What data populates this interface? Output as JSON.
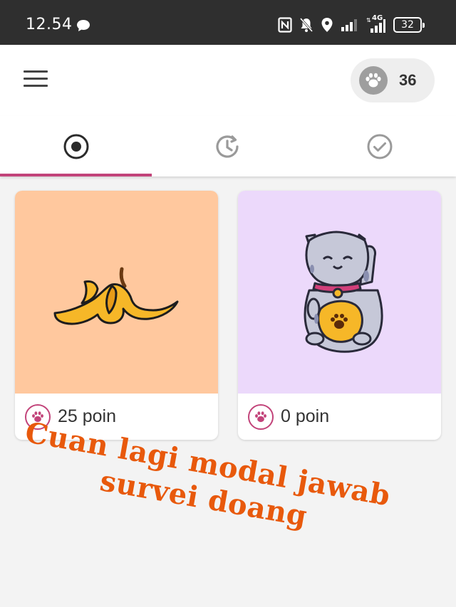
{
  "status_bar": {
    "time": "12.54",
    "network_label": "4G",
    "battery": "32"
  },
  "app_bar": {
    "points": "36"
  },
  "tabs": [
    {
      "icon": "radio-target-icon",
      "active": true
    },
    {
      "icon": "history-icon",
      "active": false
    },
    {
      "icon": "check-circle-icon",
      "active": false
    }
  ],
  "cards": [
    {
      "image": "banana-peel-illustration",
      "background": "#ffc89e",
      "points_text": "25 poin"
    },
    {
      "image": "lucky-cat-illustration",
      "background": "#ecd9fb",
      "points_text": "0 poin"
    }
  ],
  "caption": {
    "line1": "Cuan lagi modal jawab",
    "line2": "survei doang",
    "color": "#e8590c"
  },
  "colors": {
    "accent": "#c2447a",
    "status_bar": "#2f2f2f"
  }
}
